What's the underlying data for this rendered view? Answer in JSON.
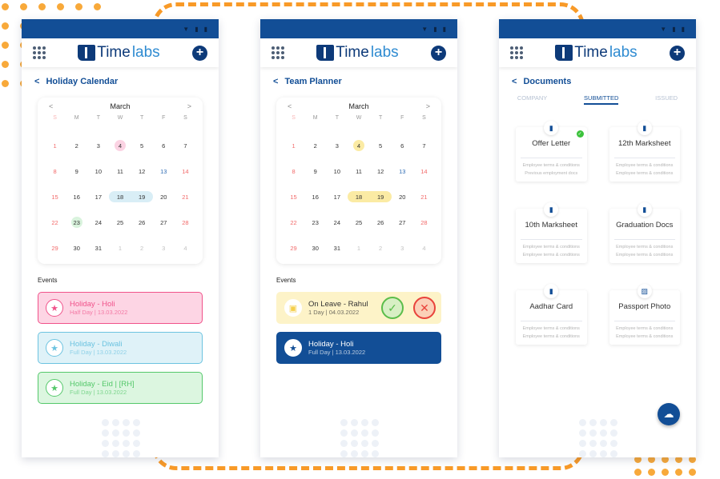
{
  "app": {
    "brand_a": "Time",
    "brand_b": "labs"
  },
  "screens": [
    {
      "title": "Holiday Calendar",
      "month": "March"
    },
    {
      "title": "Team Planner",
      "month": "March"
    },
    {
      "title": "Documents"
    }
  ],
  "calendar": {
    "weekdays": [
      "S",
      "M",
      "T",
      "W",
      "T",
      "F",
      "S"
    ],
    "weeks": [
      [
        "1",
        "2",
        "3",
        "4",
        "5",
        "6",
        "7"
      ],
      [
        "8",
        "9",
        "10",
        "11",
        "12",
        "13",
        "14"
      ],
      [
        "15",
        "16",
        "17",
        "18",
        "19",
        "20",
        "21"
      ],
      [
        "22",
        "23",
        "24",
        "25",
        "26",
        "27",
        "28"
      ],
      [
        "29",
        "30",
        "31",
        "1",
        "2",
        "3",
        "4"
      ]
    ]
  },
  "events_label": "Events",
  "holiday_events": [
    {
      "title": "Holiday - Holi",
      "sub": "Half Day | 13.03.2022",
      "color": "#f0528a"
    },
    {
      "title": "Holiday - Diwali",
      "sub": "Full Day | 13.03.2022",
      "color": "#6cc3e0"
    },
    {
      "title": "Holiday - Eid  |  [RH]",
      "sub": "Full Day | 13.03.2022",
      "color": "#54c86a"
    }
  ],
  "planner_events": [
    {
      "title": "On Leave - Rahul",
      "sub": "1 Day | 04.03.2022"
    },
    {
      "title": "Holiday - Holi",
      "sub": "Full Day | 13.03.2022"
    }
  ],
  "doc_tabs": [
    "COMPANY",
    "SUBMITTED",
    "ISSUED"
  ],
  "documents": [
    {
      "name": "Offer Letter",
      "l1": "Employee terms & conditions",
      "l2": "Previous employment docs",
      "verified": true
    },
    {
      "name": "12th Marksheet",
      "l1": "Employee terms & conditions",
      "l2": "Employee terms & conditions"
    },
    {
      "name": "10th Marksheet",
      "l1": "Employee terms & conditions",
      "l2": "Employee terms & conditions"
    },
    {
      "name": "Graduation Docs",
      "l1": "Employee terms & conditions",
      "l2": "Employee terms & conditions"
    },
    {
      "name": "Aadhar Card",
      "l1": "Employee terms & conditions",
      "l2": "Employee terms & conditions"
    },
    {
      "name": "Passport Photo",
      "l1": "Employee terms & conditions",
      "l2": "Employee terms & conditions"
    }
  ]
}
